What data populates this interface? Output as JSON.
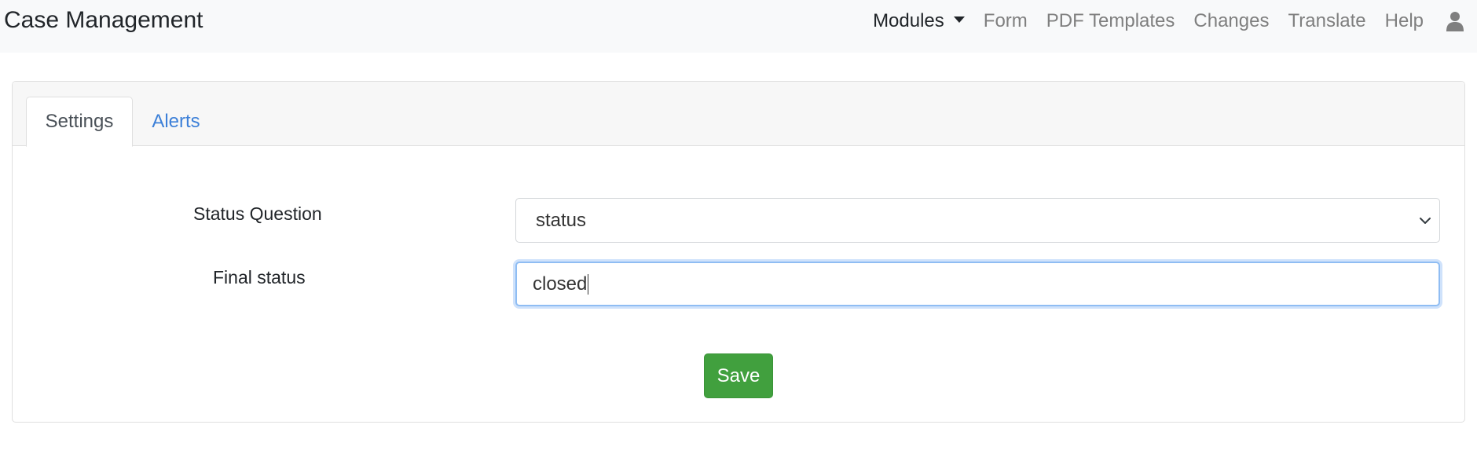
{
  "navbar": {
    "brand": "Case Management",
    "items": [
      {
        "label": "Modules",
        "active": true,
        "has_caret": true
      },
      {
        "label": "Form"
      },
      {
        "label": "PDF Templates"
      },
      {
        "label": "Changes"
      },
      {
        "label": "Translate"
      },
      {
        "label": "Help"
      }
    ],
    "user_icon": "user-icon"
  },
  "tabs": [
    {
      "label": "Settings",
      "active": true
    },
    {
      "label": "Alerts",
      "active": false
    }
  ],
  "form": {
    "status_question": {
      "label": "Status Question",
      "selected": "status"
    },
    "final_status": {
      "label": "Final status",
      "value": "closed"
    },
    "save_label": "Save"
  },
  "colors": {
    "accent_link": "#3d80d8",
    "save_button": "#41a03e",
    "navbar_bg": "#f8f9fa",
    "focus_border": "#8fbdf3"
  }
}
